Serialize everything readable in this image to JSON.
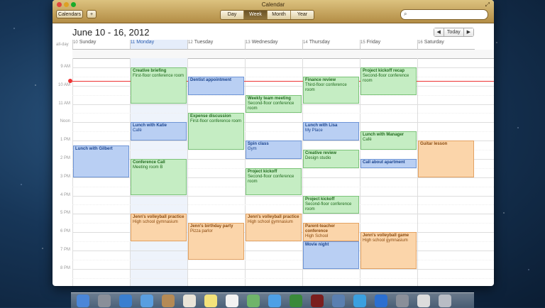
{
  "window": {
    "title": "Calendar",
    "calendars_button": "Calendars",
    "add_button": "+",
    "views": [
      "Day",
      "Week",
      "Month",
      "Year"
    ],
    "active_view": "Week",
    "search_placeholder": ""
  },
  "header": {
    "range": "June 10 - 16, 2012",
    "today_button": "Today",
    "prev_icon": "◀",
    "next_icon": "▶"
  },
  "week": {
    "all_day_label": "all-day",
    "days": [
      {
        "num": "10",
        "name": "Sunday"
      },
      {
        "num": "11",
        "name": "Monday",
        "today": true
      },
      {
        "num": "12",
        "name": "Tuesday"
      },
      {
        "num": "13",
        "name": "Wednesday"
      },
      {
        "num": "14",
        "name": "Thursday"
      },
      {
        "num": "15",
        "name": "Friday"
      },
      {
        "num": "16",
        "name": "Saturday"
      }
    ],
    "hours": [
      "9 AM",
      "10 AM",
      "11 AM",
      "Noon",
      "1 PM",
      "2 PM",
      "3 PM",
      "4 PM",
      "5 PM",
      "6 PM",
      "7 PM",
      "8 PM"
    ]
  },
  "events": [
    {
      "day": 1,
      "start": 9.0,
      "end": 11.0,
      "color": "green",
      "title": "Creative briefing",
      "sub": "First-floor conference room"
    },
    {
      "day": 2,
      "start": 9.5,
      "end": 10.5,
      "color": "blue",
      "title": "Dentist appointment",
      "sub": ""
    },
    {
      "day": 3,
      "start": 10.5,
      "end": 11.5,
      "color": "green",
      "title": "Weekly team meeting",
      "sub": "Second-floor conference room"
    },
    {
      "day": 4,
      "start": 9.5,
      "end": 11.0,
      "color": "green",
      "title": "Finance review",
      "sub": "Third-floor conference room"
    },
    {
      "day": 5,
      "start": 9.0,
      "end": 10.5,
      "color": "green",
      "title": "Project kickoff recap",
      "sub": "Second-floor conference room"
    },
    {
      "day": 1,
      "start": 12.0,
      "end": 13.0,
      "color": "blue",
      "title": "Lunch with Katie",
      "sub": "Café"
    },
    {
      "day": 2,
      "start": 11.5,
      "end": 13.5,
      "color": "green",
      "title": "Expense discussion",
      "sub": "First-floor conference room"
    },
    {
      "day": 4,
      "start": 12.0,
      "end": 13.0,
      "color": "blue",
      "title": "Lunch with Lisa",
      "sub": "My Place"
    },
    {
      "day": 5,
      "start": 12.5,
      "end": 13.5,
      "color": "green",
      "title": "Lunch with Manager",
      "sub": "Café"
    },
    {
      "day": 0,
      "start": 13.25,
      "end": 15.0,
      "color": "blue",
      "title": "Lunch with Gilbert",
      "sub": ""
    },
    {
      "day": 3,
      "start": 13.0,
      "end": 14.0,
      "color": "blue",
      "title": "Spin class",
      "sub": "Gym"
    },
    {
      "day": 4,
      "start": 13.5,
      "end": 14.5,
      "color": "green",
      "title": "Creative review",
      "sub": "Design studio"
    },
    {
      "day": 6,
      "start": 13.0,
      "end": 15.0,
      "color": "orange",
      "title": "Guitar lesson",
      "sub": ""
    },
    {
      "day": 1,
      "start": 14.0,
      "end": 16.0,
      "color": "green",
      "title": "Conference Call",
      "sub": "Meeting room B"
    },
    {
      "day": 5,
      "start": 14.0,
      "end": 14.5,
      "color": "blue",
      "title": "Call about apartment",
      "sub": ""
    },
    {
      "day": 3,
      "start": 14.5,
      "end": 16.0,
      "color": "green",
      "title": "Project kickoff",
      "sub": "Second-floor conference room"
    },
    {
      "day": 4,
      "start": 16.0,
      "end": 17.0,
      "color": "green",
      "title": "Project kickoff",
      "sub": "Second-floor conference room"
    },
    {
      "day": 1,
      "start": 17.0,
      "end": 18.5,
      "color": "orange",
      "title": "Jenn's volleyball practice",
      "sub": "High school gymnasium"
    },
    {
      "day": 2,
      "start": 17.5,
      "end": 19.5,
      "color": "orange",
      "title": "Jenn's birthday party",
      "sub": "Pizza parlor"
    },
    {
      "day": 3,
      "start": 17.0,
      "end": 18.5,
      "color": "orange",
      "title": "Jenn's volleyball practice",
      "sub": "High school gymnasium"
    },
    {
      "day": 4,
      "start": 17.5,
      "end": 18.5,
      "color": "orange",
      "title": "Parent-teacher conference",
      "sub": "High School"
    },
    {
      "day": 5,
      "start": 18.0,
      "end": 20.0,
      "color": "orange",
      "title": "Jenn's volleyball game",
      "sub": "High school gymnasium"
    },
    {
      "day": 4,
      "start": 18.5,
      "end": 20.0,
      "color": "blue",
      "title": "Movie night",
      "sub": ""
    }
  ],
  "current_time_hour": 9.75,
  "dock": {
    "icons": [
      "finder-icon",
      "launchpad-icon",
      "safari-icon",
      "mail-icon",
      "contacts-icon",
      "calendar-icon",
      "notes-icon",
      "reminders-icon",
      "maps-icon",
      "messages-icon",
      "facetime-icon",
      "photo-booth-icon",
      "iphoto-icon",
      "itunes-icon",
      "app-store-icon",
      "system-preferences-icon",
      "documents-icon",
      "trash-icon"
    ]
  }
}
